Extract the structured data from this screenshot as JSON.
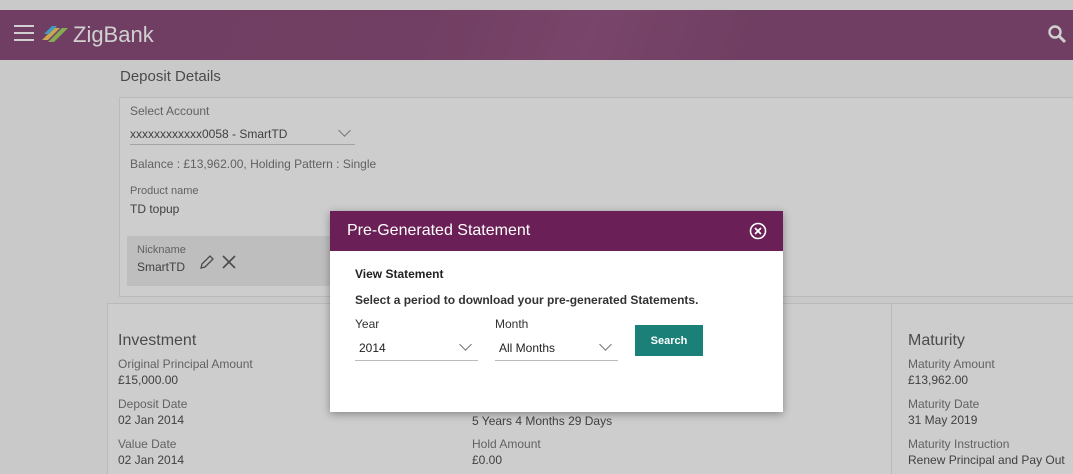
{
  "app": {
    "name": "ZigBank"
  },
  "page": {
    "title": "Deposit Details",
    "select_account_label": "Select Account",
    "account_value": "xxxxxxxxxxxx0058 - SmartTD",
    "balance_text": "Balance : £13,962.00, Holding Pattern : Single",
    "product_name_label": "Product name",
    "product_name_value": "TD topup",
    "nickname_label": "Nickname",
    "nickname_value": "SmartTD"
  },
  "investment": {
    "title": "Investment",
    "original_principal_label": "Original Principal Amount",
    "original_principal_value": "£15,000.00",
    "deposit_date_label": "Deposit Date",
    "deposit_date_value": "02 Jan 2014",
    "value_date_label": "Value Date",
    "value_date_value": "02 Jan 2014"
  },
  "middle": {
    "term_value": "5 Years 4 Months 29 Days",
    "hold_amount_label": "Hold Amount",
    "hold_amount_value": "£0.00"
  },
  "maturity": {
    "title": "Maturity",
    "maturity_amount_label": "Maturity Amount",
    "maturity_amount_value": "£13,962.00",
    "maturity_date_label": "Maturity Date",
    "maturity_date_value": "31 May 2019",
    "maturity_instruction_label": "Maturity Instruction",
    "maturity_instruction_value": "Renew Principal and Pay Out"
  },
  "modal": {
    "title": "Pre-Generated Statement",
    "view_statement": "View Statement",
    "instruction": "Select a period to download your pre-generated Statements.",
    "year_label": "Year",
    "year_value": "2014",
    "month_label": "Month",
    "month_value": "All Months",
    "search_label": "Search"
  },
  "colors": {
    "brand": "#6a2056",
    "button": "#1b8178"
  }
}
